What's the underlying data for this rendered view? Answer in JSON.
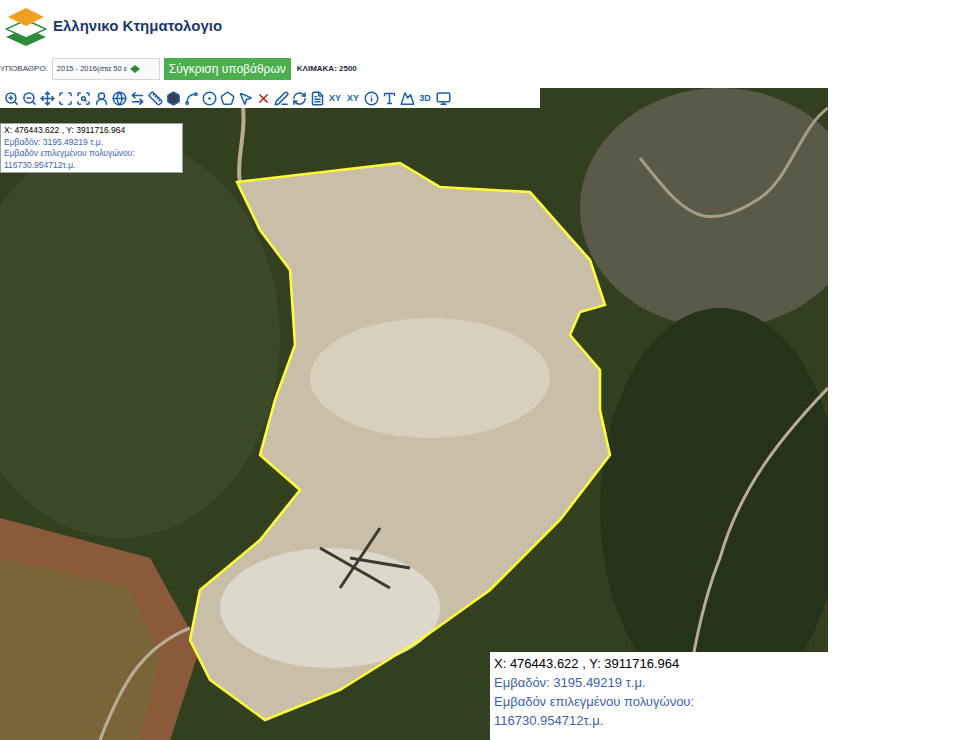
{
  "logo": {
    "text": "Ελληνικο Κτηματολογιο"
  },
  "controls": {
    "basemap_label": "ΥΠΟΒΑΘΡΟ:",
    "basemap_value": "2015 - 2016(στα 50 ε",
    "compare_button": "Σύγκριση υποβάθρων",
    "scale": "ΚΛΙΜΑΚΑ: 2500"
  },
  "tool_labels": [
    "XY",
    "XY",
    "3D"
  ],
  "info_boxes": [
    {
      "coords": "X: 476443.622 , Y: 3911716.964",
      "area": "Εμβαδόν: 3195.49219 τ.μ.",
      "polygon_area_label": "Εμβαδόν επιλεγμένου πολυγώνου:",
      "polygon_area": "116730.954712τ.μ."
    },
    {
      "coords": "X: 476443.622 , Y: 3911716.964",
      "area": "Εμβαδόν: 3195.49219 τ.μ.",
      "polygon_area_label": "Εμβαδόν επιλεγμένου πολυγώνου:",
      "polygon_area": "116730.954712τ.μ."
    }
  ]
}
